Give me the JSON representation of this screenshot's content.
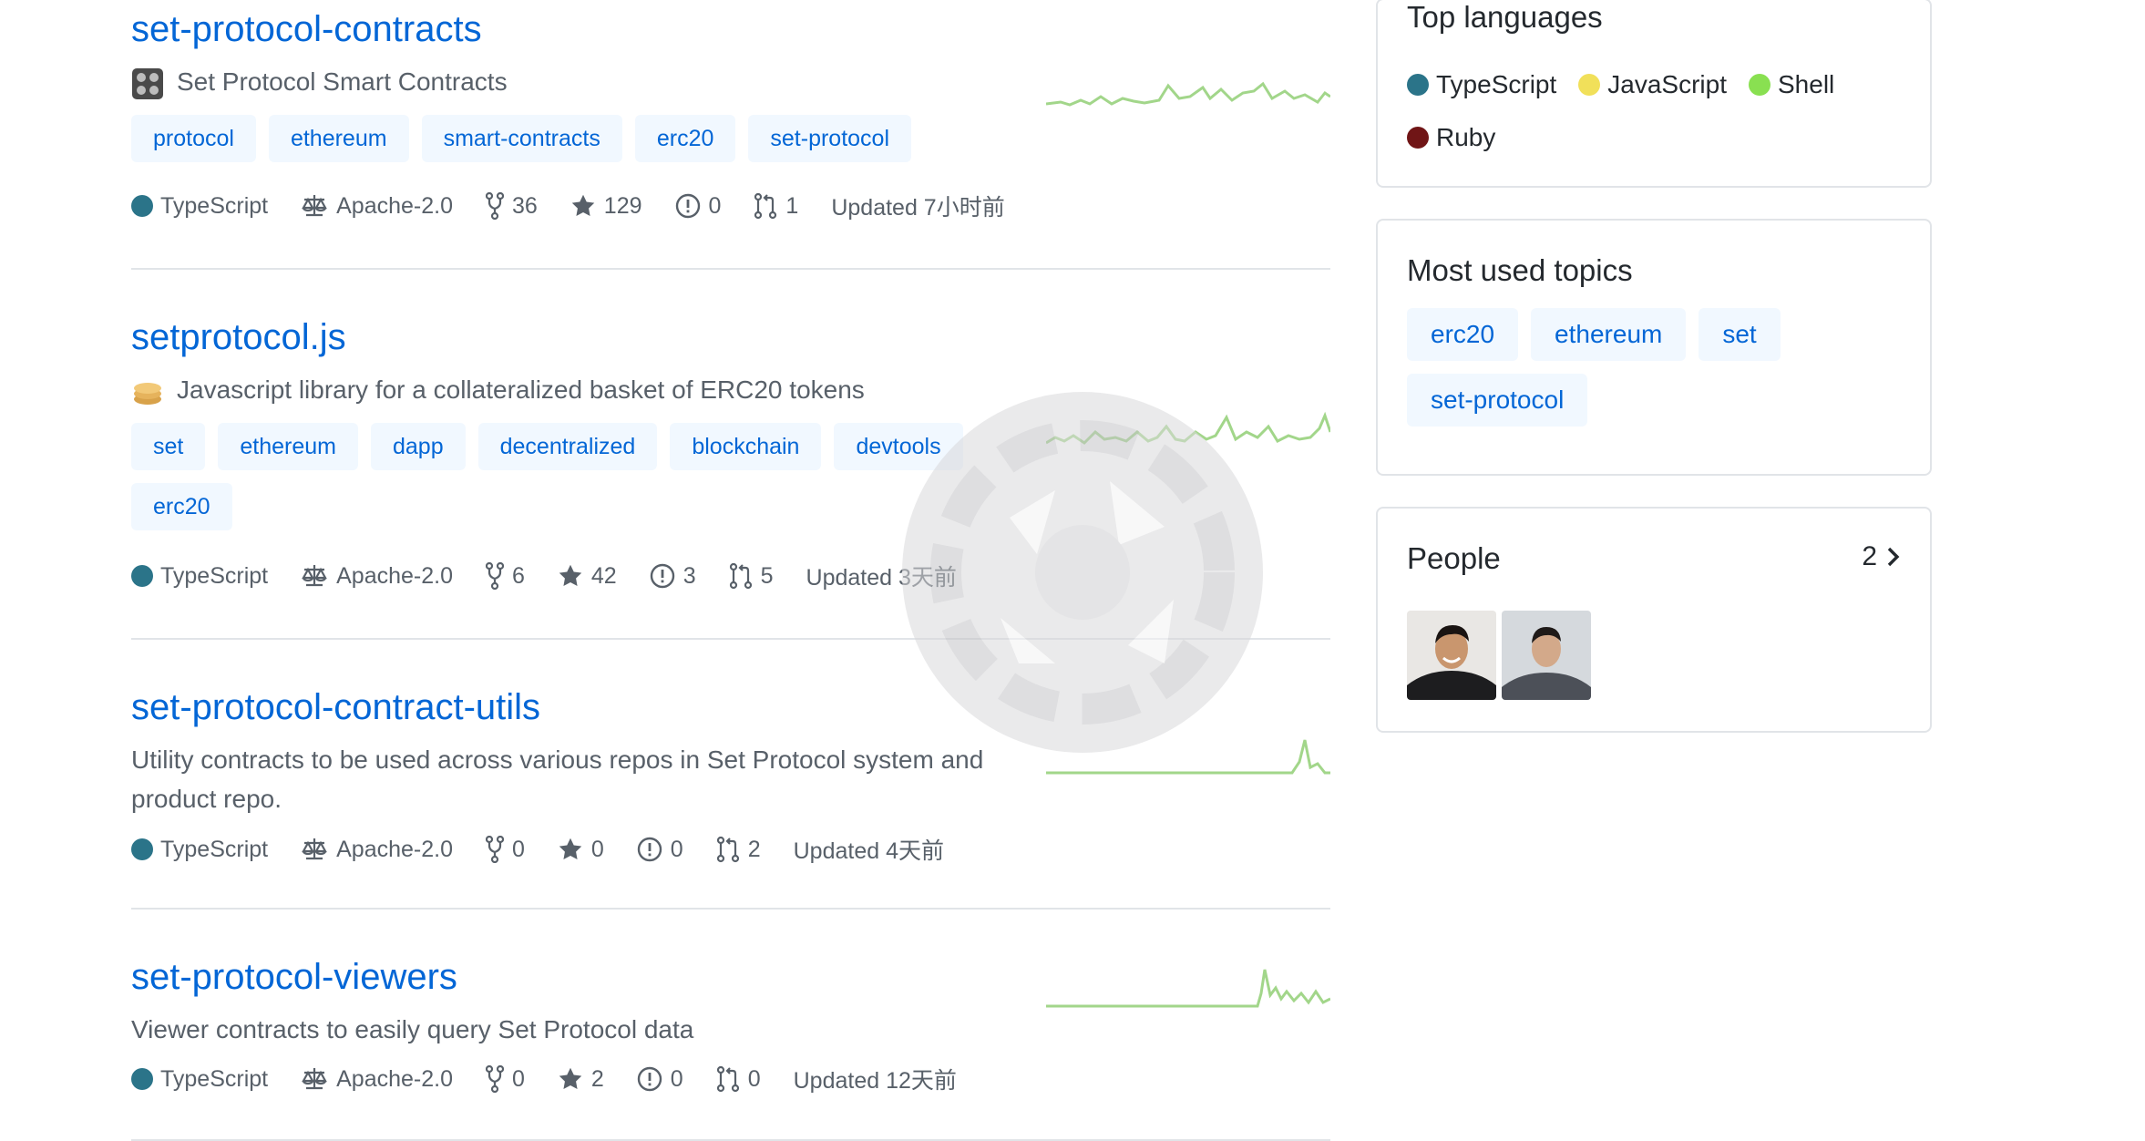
{
  "repos": [
    {
      "name": "set-protocol-contracts",
      "description": "Set Protocol Smart Contracts",
      "topics": [
        "protocol",
        "ethereum",
        "smart-contracts",
        "erc20",
        "set-protocol"
      ],
      "language": "TypeScript",
      "language_color": "#2b7489",
      "license": "Apache-2.0",
      "forks": "36",
      "stars": "129",
      "issues": "0",
      "pull_requests": "1",
      "updated": "Updated 7小时前"
    },
    {
      "name": "setprotocol.js",
      "description": "Javascript library for a collateralized basket of ERC20 tokens",
      "topics": [
        "set",
        "ethereum",
        "dapp",
        "decentralized",
        "blockchain",
        "devtools",
        "erc20"
      ],
      "language": "TypeScript",
      "language_color": "#2b7489",
      "license": "Apache-2.0",
      "forks": "6",
      "stars": "42",
      "issues": "3",
      "pull_requests": "5",
      "updated": "Updated 3天前"
    },
    {
      "name": "set-protocol-contract-utils",
      "description_line1": "Utility contracts to be used across various repos in Set Protocol system and",
      "description_line2": "product repo.",
      "language": "TypeScript",
      "language_color": "#2b7489",
      "license": "Apache-2.0",
      "forks": "0",
      "stars": "0",
      "issues": "0",
      "pull_requests": "2",
      "updated": "Updated 4天前"
    },
    {
      "name": "set-protocol-viewers",
      "description": "Viewer contracts to easily query Set Protocol data",
      "language": "TypeScript",
      "language_color": "#2b7489",
      "license": "Apache-2.0",
      "forks": "0",
      "stars": "2",
      "issues": "0",
      "pull_requests": "0",
      "updated": "Updated 12天前"
    }
  ],
  "top_languages": {
    "title": "Top languages",
    "items": [
      {
        "name": "TypeScript",
        "color": "#2b7489"
      },
      {
        "name": "JavaScript",
        "color": "#f1e05a"
      },
      {
        "name": "Shell",
        "color": "#89e051"
      },
      {
        "name": "Ruby",
        "color": "#701516"
      }
    ]
  },
  "most_used_topics": {
    "title": "Most used topics",
    "items": [
      "erc20",
      "ethereum",
      "set",
      "set-protocol"
    ]
  },
  "people": {
    "title": "People",
    "count": "2"
  },
  "icons": {
    "license": "law-icon",
    "forks": "repo-forked-icon",
    "stars": "star-icon",
    "issues": "issue-opened-icon",
    "pull_requests": "git-pull-request-icon",
    "people_more": "chevron-right-icon"
  },
  "colors": {
    "link": "#0366d6",
    "topic_bg": "#f1f8ff",
    "sparkline": "#a2d68a",
    "border": "#e1e4e8"
  }
}
